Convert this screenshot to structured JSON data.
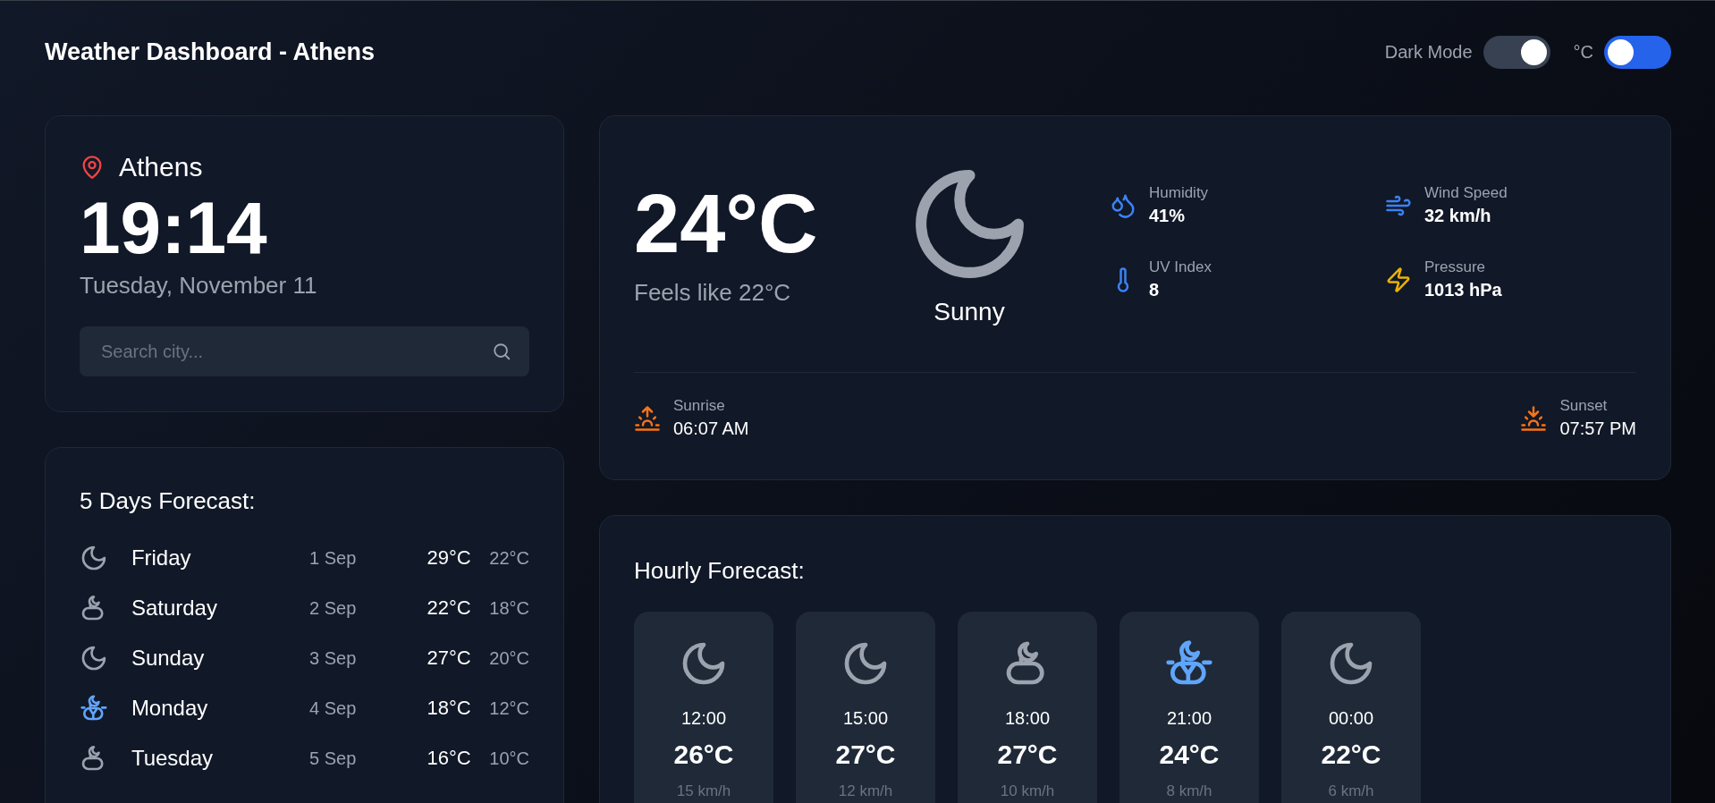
{
  "header": {
    "title": "Weather Dashboard - Athens",
    "toggles": [
      {
        "label": "Dark Mode",
        "on": true,
        "color": "#374151"
      },
      {
        "label": "°C",
        "on": false,
        "color": "#2563eb"
      }
    ]
  },
  "location": {
    "city": "Athens",
    "time": "19:14",
    "date": "Tuesday, November 11"
  },
  "search": {
    "placeholder": "Search city..."
  },
  "daily_forecast": {
    "title": "5 Days Forecast:",
    "days": [
      {
        "kind": "clear-night",
        "day": "Friday",
        "date": "1 Sep",
        "high": "29°C",
        "low": "22°C"
      },
      {
        "kind": "cloudy-night",
        "day": "Saturday",
        "date": "2 Sep",
        "high": "22°C",
        "low": "18°C"
      },
      {
        "kind": "clear-night",
        "day": "Sunday",
        "date": "3 Sep",
        "high": "27°C",
        "low": "20°C"
      },
      {
        "kind": "storm",
        "day": "Monday",
        "date": "4 Sep",
        "high": "18°C",
        "low": "12°C"
      },
      {
        "kind": "cloudy-night",
        "day": "Tuesday",
        "date": "5 Sep",
        "high": "16°C",
        "low": "10°C"
      }
    ]
  },
  "current": {
    "temperature": "24°C",
    "feels_like": "Feels like 22°C",
    "kind": "clear-night",
    "description": "Sunny",
    "stats": [
      {
        "kind": "humidity",
        "label": "Humidity",
        "value": "41%"
      },
      {
        "kind": "wind",
        "label": "Wind Speed",
        "value": "32 km/h"
      },
      {
        "kind": "uv",
        "label": "UV Index",
        "value": "8"
      },
      {
        "kind": "pressure",
        "label": "Pressure",
        "value": "1013 hPa"
      }
    ],
    "sun": [
      {
        "kind": "sunrise",
        "label": "Sunrise",
        "value": "06:07 AM"
      },
      {
        "kind": "sunset",
        "label": "Sunset",
        "value": "07:57 PM"
      }
    ]
  },
  "hourly_forecast": {
    "title": "Hourly Forecast:",
    "hours": [
      {
        "kind": "clear-night",
        "time": "12:00",
        "temperature": "26°C",
        "wind": "15 km/h"
      },
      {
        "kind": "clear-night",
        "time": "15:00",
        "temperature": "27°C",
        "wind": "12 km/h"
      },
      {
        "kind": "cloudy-night",
        "time": "18:00",
        "temperature": "27°C",
        "wind": "10 km/h"
      },
      {
        "kind": "storm",
        "time": "21:00",
        "temperature": "24°C",
        "wind": "8 km/h"
      },
      {
        "kind": "clear-night",
        "time": "00:00",
        "temperature": "22°C",
        "wind": "6 km/h"
      }
    ]
  }
}
